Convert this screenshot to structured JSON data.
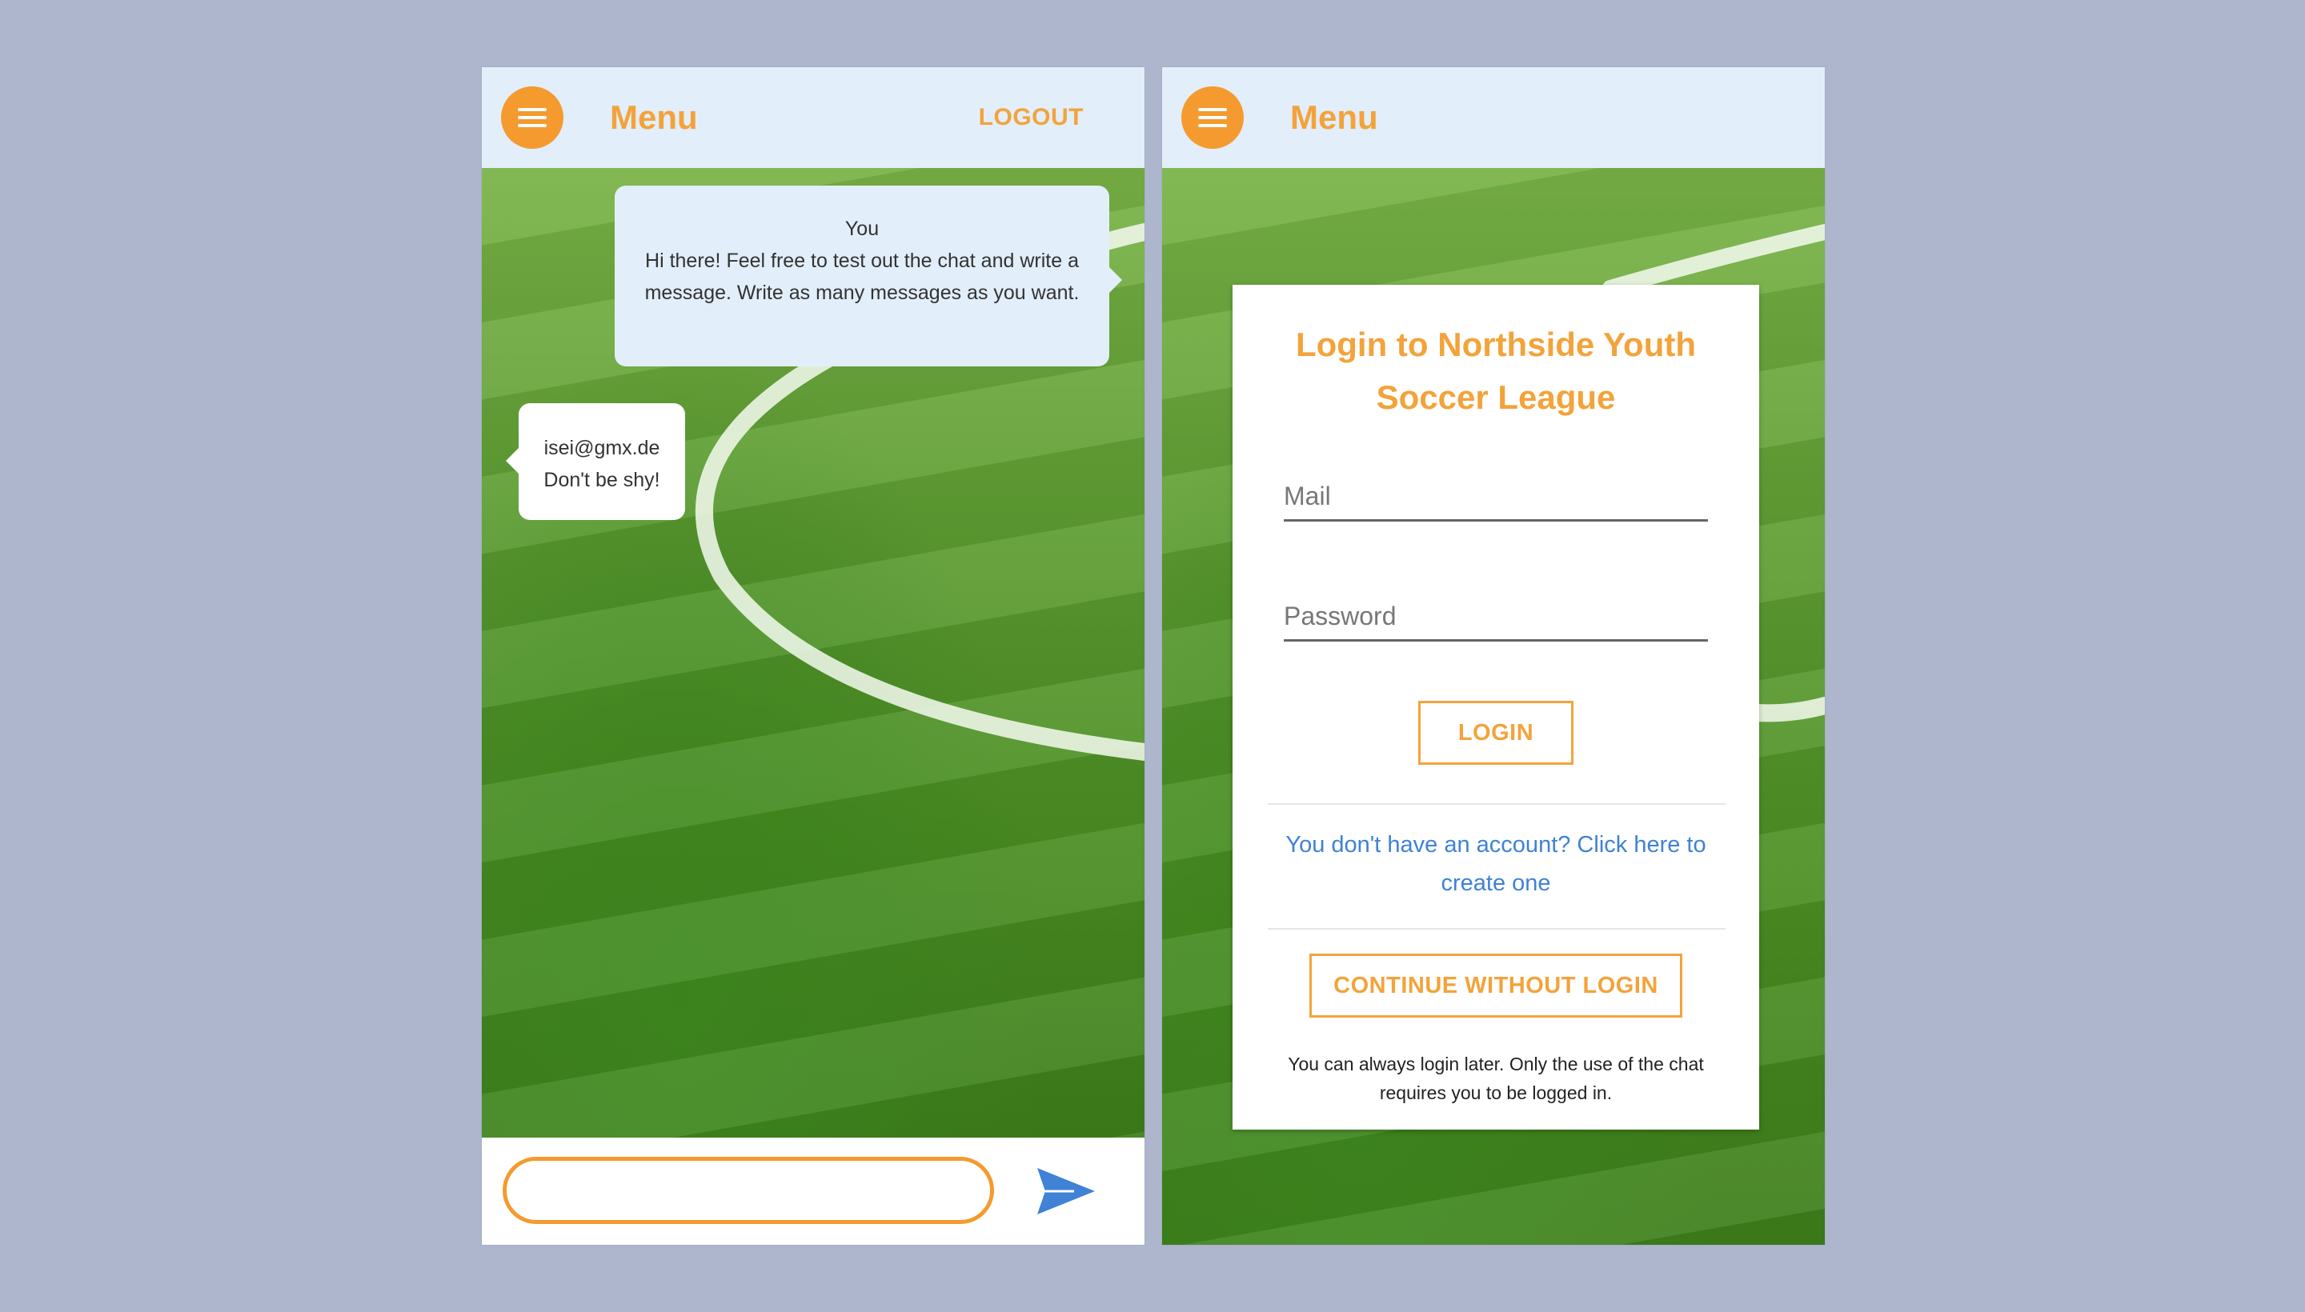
{
  "colors": {
    "accent": "#f59a2e",
    "appbar_bg": "#e2eef9",
    "link": "#3f82d6",
    "page_bg": "#adb6cc"
  },
  "chat_screen": {
    "header": {
      "menu_icon": "hamburger-menu-icon",
      "title": "Menu",
      "logout_label": "LOGOUT"
    },
    "messages": [
      {
        "sender": "You",
        "text": "Hi there! Feel free to test out the chat and write a message. Write as many messages as you want.",
        "side": "right"
      },
      {
        "sender": "isei@gmx.de",
        "text": "Don't be shy!",
        "side": "left"
      }
    ],
    "composer": {
      "input_value": "",
      "send_icon": "send-arrow-icon"
    }
  },
  "login_screen": {
    "header": {
      "menu_icon": "hamburger-menu-icon",
      "title": "Menu"
    },
    "card": {
      "title": "Login to Northside Youth Soccer League",
      "mail_placeholder": "Mail",
      "password_placeholder": "Password",
      "login_label": "LOGIN",
      "register_link": "You don't have an account? Click here to create one",
      "continue_label": "CONTINUE WITHOUT LOGIN",
      "note": "You can always login later. Only the use of the chat requires you to be logged in."
    }
  }
}
